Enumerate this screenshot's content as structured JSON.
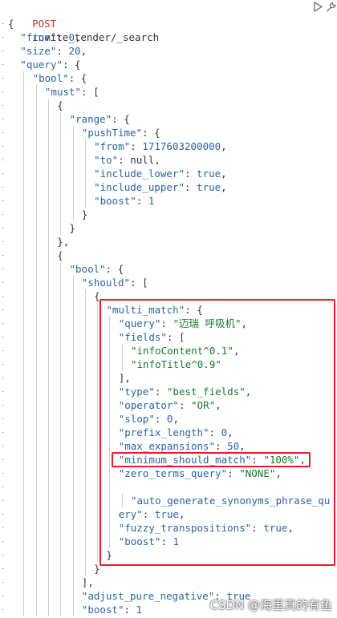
{
  "request": {
    "method": "POST",
    "path": "invite_tender/_search"
  },
  "toolbar": {
    "play_icon": "play-icon",
    "settings_icon": "wrench-icon"
  },
  "code_lines": [
    {
      "indent": 0,
      "tokens": [
        [
          "p",
          "{"
        ]
      ]
    },
    {
      "indent": 1,
      "tokens": [
        [
          "k",
          "\"from\""
        ],
        [
          "p",
          ": "
        ],
        [
          "n",
          "0"
        ],
        [
          "p",
          ","
        ]
      ]
    },
    {
      "indent": 1,
      "tokens": [
        [
          "k",
          "\"size\""
        ],
        [
          "p",
          ": "
        ],
        [
          "n",
          "20"
        ],
        [
          "p",
          ","
        ]
      ]
    },
    {
      "indent": 1,
      "tokens": [
        [
          "k",
          "\"query\""
        ],
        [
          "p",
          ": {"
        ]
      ]
    },
    {
      "indent": 2,
      "tokens": [
        [
          "k",
          "\"bool\""
        ],
        [
          "p",
          ": {"
        ]
      ]
    },
    {
      "indent": 3,
      "tokens": [
        [
          "k",
          "\"must\""
        ],
        [
          "p",
          ": ["
        ]
      ]
    },
    {
      "indent": 4,
      "tokens": [
        [
          "p",
          "{"
        ]
      ]
    },
    {
      "indent": 5,
      "tokens": [
        [
          "k",
          "\"range\""
        ],
        [
          "p",
          ": {"
        ]
      ]
    },
    {
      "indent": 6,
      "tokens": [
        [
          "k",
          "\"pushTime\""
        ],
        [
          "p",
          ": {"
        ]
      ]
    },
    {
      "indent": 7,
      "tokens": [
        [
          "k",
          "\"from\""
        ],
        [
          "p",
          ": "
        ],
        [
          "n",
          "1717603200000"
        ],
        [
          "p",
          ","
        ]
      ]
    },
    {
      "indent": 7,
      "tokens": [
        [
          "k",
          "\"to\""
        ],
        [
          "p",
          ": null,"
        ]
      ]
    },
    {
      "indent": 7,
      "tokens": [
        [
          "k",
          "\"include_lower\""
        ],
        [
          "p",
          ": "
        ],
        [
          "n",
          "true"
        ],
        [
          "p",
          ","
        ]
      ]
    },
    {
      "indent": 7,
      "tokens": [
        [
          "k",
          "\"include_upper\""
        ],
        [
          "p",
          ": "
        ],
        [
          "n",
          "true"
        ],
        [
          "p",
          ","
        ]
      ]
    },
    {
      "indent": 7,
      "tokens": [
        [
          "k",
          "\"boost\""
        ],
        [
          "p",
          ": "
        ],
        [
          "n",
          "1"
        ]
      ]
    },
    {
      "indent": 6,
      "tokens": [
        [
          "p",
          "}"
        ]
      ]
    },
    {
      "indent": 5,
      "tokens": [
        [
          "p",
          "}"
        ]
      ]
    },
    {
      "indent": 4,
      "tokens": [
        [
          "p",
          "},"
        ]
      ]
    },
    {
      "indent": 4,
      "tokens": [
        [
          "p",
          "{"
        ]
      ]
    },
    {
      "indent": 5,
      "tokens": [
        [
          "k",
          "\"bool\""
        ],
        [
          "p",
          ": {"
        ]
      ]
    },
    {
      "indent": 6,
      "tokens": [
        [
          "k",
          "\"should\""
        ],
        [
          "p",
          ": ["
        ]
      ]
    },
    {
      "indent": 7,
      "tokens": [
        [
          "p",
          "{"
        ]
      ]
    },
    {
      "indent": 8,
      "tokens": [
        [
          "k",
          "\"multi_match\""
        ],
        [
          "p",
          ": {"
        ]
      ]
    },
    {
      "indent": 9,
      "tokens": [
        [
          "k",
          "\"query\""
        ],
        [
          "p",
          ": "
        ],
        [
          "s",
          "\"迈瑞 呼吸机\""
        ],
        [
          "p",
          ","
        ]
      ]
    },
    {
      "indent": 9,
      "tokens": [
        [
          "k",
          "\"fields\""
        ],
        [
          "p",
          ": ["
        ]
      ]
    },
    {
      "indent": 10,
      "tokens": [
        [
          "s",
          "\"infoContent^0.1\""
        ],
        [
          "p",
          ","
        ]
      ]
    },
    {
      "indent": 10,
      "tokens": [
        [
          "s",
          "\"infoTitle^0.9\""
        ]
      ]
    },
    {
      "indent": 9,
      "tokens": [
        [
          "p",
          "],"
        ]
      ]
    },
    {
      "indent": 9,
      "tokens": [
        [
          "k",
          "\"type\""
        ],
        [
          "p",
          ": "
        ],
        [
          "s",
          "\"best_fields\""
        ],
        [
          "p",
          ","
        ]
      ]
    },
    {
      "indent": 9,
      "tokens": [
        [
          "k",
          "\"operator\""
        ],
        [
          "p",
          ": "
        ],
        [
          "s",
          "\"OR\""
        ],
        [
          "p",
          ","
        ]
      ]
    },
    {
      "indent": 9,
      "tokens": [
        [
          "k",
          "\"slop\""
        ],
        [
          "p",
          ": "
        ],
        [
          "n",
          "0"
        ],
        [
          "p",
          ","
        ]
      ]
    },
    {
      "indent": 9,
      "tokens": [
        [
          "k",
          "\"prefix_length\""
        ],
        [
          "p",
          ": "
        ],
        [
          "n",
          "0"
        ],
        [
          "p",
          ","
        ]
      ]
    },
    {
      "indent": 9,
      "tokens": [
        [
          "k",
          "\"max_expansions\""
        ],
        [
          "p",
          ": "
        ],
        [
          "n",
          "50"
        ],
        [
          "p",
          ","
        ]
      ]
    },
    {
      "indent": 9,
      "tokens": [
        [
          "k",
          "\"minimum_should_match\""
        ],
        [
          "p",
          ": "
        ],
        [
          "s",
          "\"100%\""
        ],
        [
          "p",
          ","
        ]
      ]
    },
    {
      "indent": 9,
      "tokens": [
        [
          "k",
          "\"zero_terms_query\""
        ],
        [
          "p",
          ": "
        ],
        [
          "s",
          "\"NONE\""
        ],
        [
          "p",
          ","
        ]
      ]
    },
    {
      "indent": 9,
      "tokens": []
    },
    {
      "indent": 10,
      "tokens": [
        [
          "k",
          "\"auto_generate_synonyms_phrase_qu"
        ]
      ]
    },
    {
      "indent": 9,
      "tokens": [
        [
          "k",
          "ery\""
        ],
        [
          "p",
          ": "
        ],
        [
          "n",
          "true"
        ],
        [
          "p",
          ","
        ]
      ]
    },
    {
      "indent": 9,
      "tokens": [
        [
          "k",
          "\"fuzzy_transpositions\""
        ],
        [
          "p",
          ": "
        ],
        [
          "n",
          "true"
        ],
        [
          "p",
          ","
        ]
      ]
    },
    {
      "indent": 9,
      "tokens": [
        [
          "k",
          "\"boost\""
        ],
        [
          "p",
          ": "
        ],
        [
          "n",
          "1"
        ]
      ]
    },
    {
      "indent": 8,
      "tokens": [
        [
          "p",
          "}"
        ]
      ]
    },
    {
      "indent": 7,
      "tokens": [
        [
          "p",
          "}"
        ]
      ]
    },
    {
      "indent": 6,
      "tokens": [
        [
          "p",
          "],"
        ]
      ]
    },
    {
      "indent": 6,
      "tokens": [
        [
          "k",
          "\"adjust_pure_negative\""
        ],
        [
          "p",
          ": "
        ],
        [
          "n",
          "true"
        ]
      ]
    },
    {
      "indent": 6,
      "tokens": [
        [
          "k",
          "\"boost\""
        ],
        [
          "p",
          ": "
        ],
        [
          "n",
          "1"
        ]
      ]
    }
  ],
  "watermark": "CSDN @海里真的有鱼"
}
